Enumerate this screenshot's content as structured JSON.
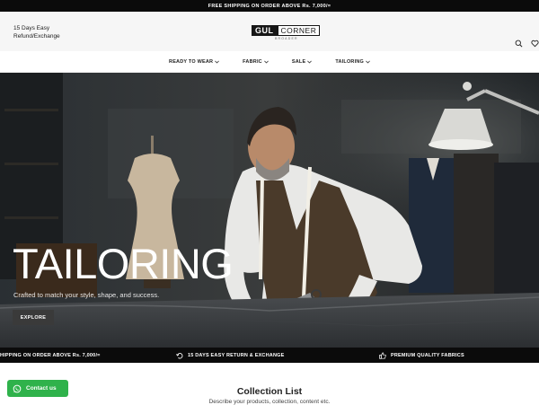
{
  "announcement": "FREE SHIPPING ON ORDER ABOVE Rs. 7,000/=",
  "header": {
    "promo_line1": "15 Days Easy",
    "promo_line2": "Refund/Exchange",
    "logo_part1": "GUL",
    "logo_part2": "CORNER",
    "logo_sub": "BROADER",
    "icons": [
      "search-icon",
      "heart-icon"
    ]
  },
  "nav": {
    "items": [
      {
        "label": "READY TO WEAR"
      },
      {
        "label": "FABRIC"
      },
      {
        "label": "SALE"
      },
      {
        "label": "TAILORING"
      }
    ]
  },
  "hero": {
    "title": "TAILORING",
    "subtitle": "Crafted to match your style, shape, and success.",
    "button": "EXPLORE"
  },
  "features": {
    "items": [
      {
        "label": "HIPPING ON ORDER ABOVE Rs. 7,000/=",
        "icon": ""
      },
      {
        "label": "15 DAYS EASY RETURN & EXCHANGE",
        "icon": "return-icon"
      },
      {
        "label": "PREMIUM QUALITY FABRICS",
        "icon": "thumbs-up-icon"
      }
    ]
  },
  "collection": {
    "title": "Collection List",
    "subtitle": "Describe your products, collection, content etc."
  },
  "whatsapp": {
    "label": "Contact us"
  }
}
